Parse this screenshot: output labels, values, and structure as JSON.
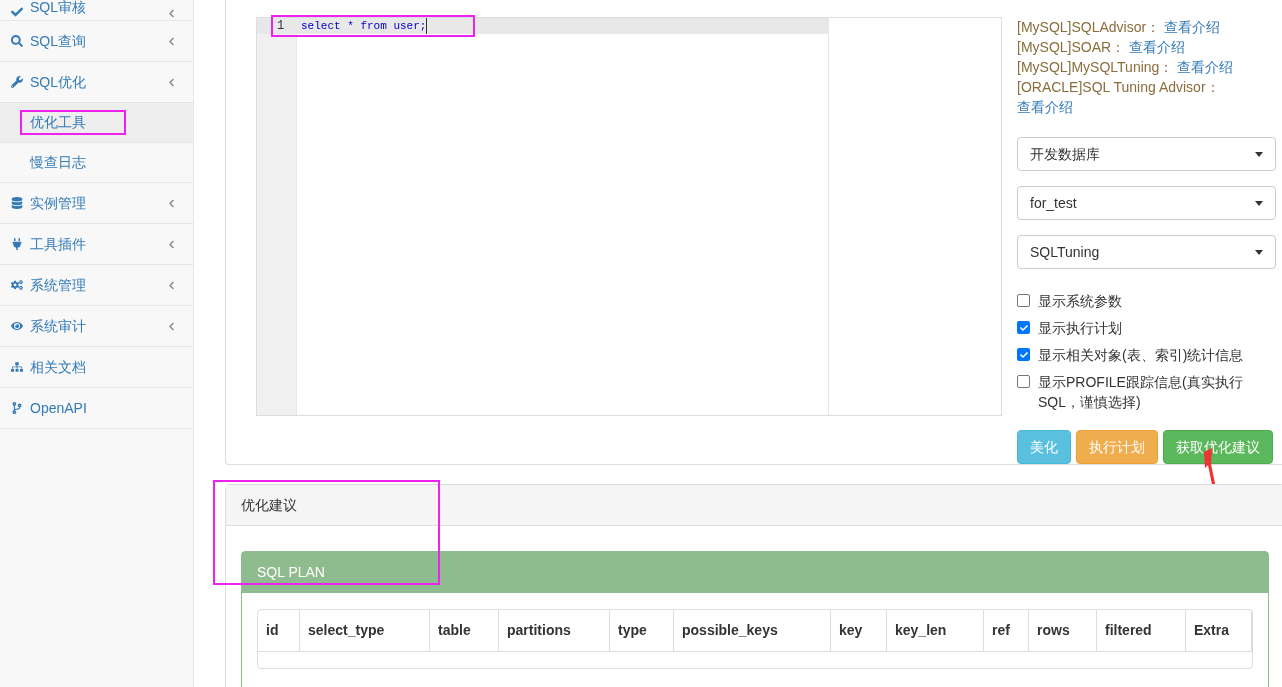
{
  "sidebar": {
    "items": [
      {
        "label": "SQL审核",
        "expandable": true,
        "selected": false
      },
      {
        "label": "SQL查询",
        "expandable": true,
        "selected": false
      },
      {
        "label": "SQL优化",
        "expandable": true,
        "selected": false,
        "children": [
          {
            "label": "优化工具",
            "selected": true
          },
          {
            "label": "慢查日志",
            "selected": false
          }
        ]
      },
      {
        "label": "实例管理",
        "expandable": true,
        "selected": false
      },
      {
        "label": "工具插件",
        "expandable": true,
        "selected": false
      },
      {
        "label": "系统管理",
        "expandable": true,
        "selected": false
      },
      {
        "label": "系统审计",
        "expandable": true,
        "selected": false
      },
      {
        "label": "相关文档",
        "expandable": false,
        "selected": false
      },
      {
        "label": "OpenAPI",
        "expandable": false,
        "selected": false
      }
    ]
  },
  "editor": {
    "lines": [
      {
        "number": "1",
        "code": "select * from user;"
      }
    ]
  },
  "tools": [
    {
      "name": "[MySQL]SQLAdvisor：",
      "link": "查看介绍"
    },
    {
      "name": "[MySQL]SOAR：",
      "link": "查看介绍"
    },
    {
      "name": "[MySQL]MySQLTuning：",
      "link": "查看介绍"
    },
    {
      "name": "[ORACLE]SQL Tuning Advisor：",
      "link": "查看介绍"
    }
  ],
  "selects": [
    {
      "value": "开发数据库"
    },
    {
      "value": "for_test"
    },
    {
      "value": "SQLTuning"
    }
  ],
  "options": [
    {
      "label": "显示系统参数",
      "checked": false
    },
    {
      "label": "显示执行计划",
      "checked": true
    },
    {
      "label": "显示相关对象(表、索引)统计信息",
      "checked": true
    },
    {
      "label": "显示PROFILE跟踪信息(真实执行SQL，谨慎选择)",
      "checked": false
    }
  ],
  "buttons": [
    {
      "label": "美化",
      "kind": "info"
    },
    {
      "label": "执行计划",
      "kind": "warning"
    },
    {
      "label": "获取优化建议",
      "kind": "success"
    }
  ],
  "result": {
    "title": "优化建议",
    "plan_title": "SQL PLAN",
    "columns": [
      "id",
      "select_type",
      "table",
      "partitions",
      "type",
      "possible_keys",
      "key",
      "key_len",
      "ref",
      "rows",
      "filtered",
      "Extra"
    ]
  }
}
